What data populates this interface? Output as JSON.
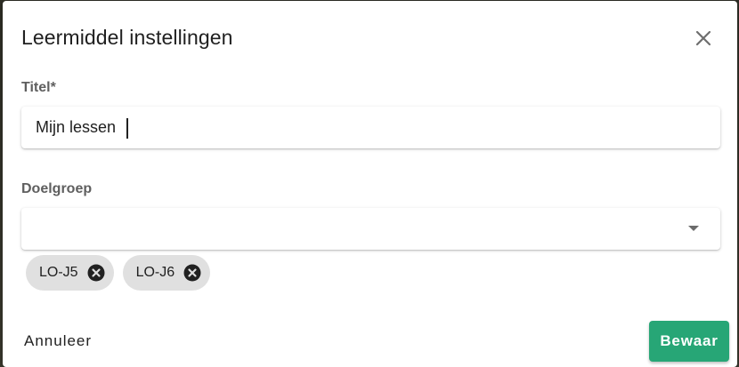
{
  "dialog": {
    "title": "Leermiddel instellingen"
  },
  "fields": {
    "titel": {
      "label": "Titel*",
      "value": "Mijn lessen"
    },
    "doelgroep": {
      "label": "Doelgroep",
      "selected": "",
      "chips": [
        {
          "label": "LO-J5"
        },
        {
          "label": "LO-J6"
        }
      ]
    }
  },
  "actions": {
    "cancel_label": "Annuleer",
    "save_label": "Bewaar"
  },
  "colors": {
    "accent": "#27a676",
    "chip_bg": "#e0e0e0",
    "label_text": "#5f5f5f"
  },
  "icons": {
    "close": "close-icon",
    "dropdown": "triangle-down-icon",
    "chip_remove": "circle-x-icon"
  }
}
